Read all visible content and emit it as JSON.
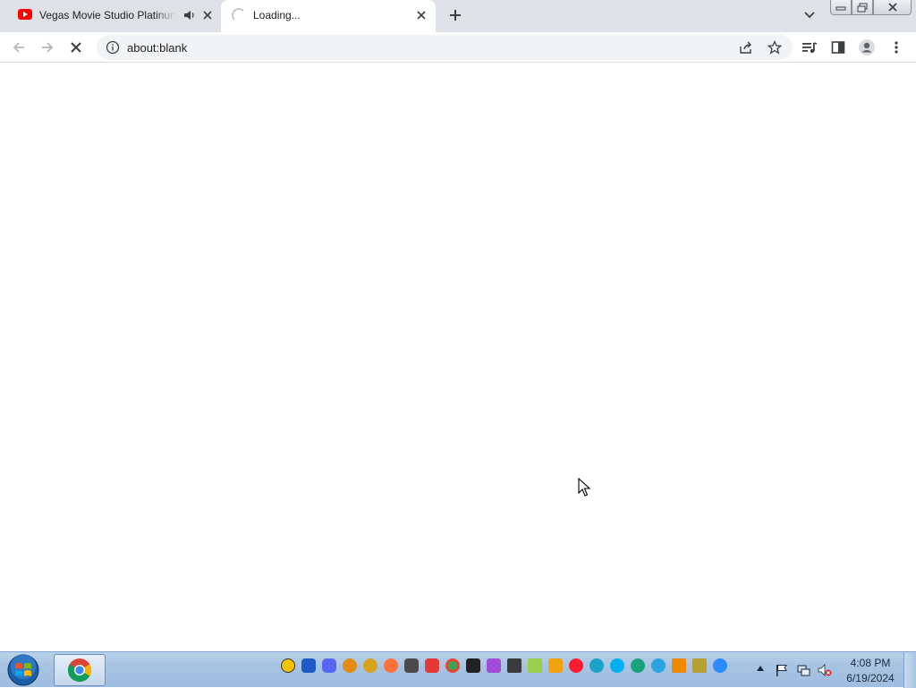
{
  "browser": {
    "tabs": [
      {
        "title": "Vegas Movie Studio Platinum",
        "favicon": "youtube-icon",
        "audio": true,
        "active": false
      },
      {
        "title": "Loading...",
        "favicon": "loading-spinner-icon",
        "audio": false,
        "active": true
      }
    ],
    "new_tab_icon": "plus-icon",
    "tab_search_icon": "chevron-down-icon",
    "window_controls": [
      "minimize-icon",
      "maximize-icon",
      "close-icon"
    ]
  },
  "toolbar": {
    "back_icon": "back-arrow-icon",
    "forward_icon": "forward-arrow-icon",
    "stop_icon": "stop-icon",
    "site_info_icon": "info-icon",
    "url": "about:blank",
    "share_icon": "share-icon",
    "bookmark_icon": "star-icon",
    "media_icon": "media-control-icon",
    "side_panel_icon": "side-panel-icon",
    "profile_icon": "profile-icon",
    "menu_icon": "more-vert-icon"
  },
  "taskbar": {
    "start_icon": "windows-start-icon",
    "pinned": [
      "chrome-icon"
    ],
    "tray_apps": [
      "triangle-app-icon",
      "headphones-app-icon",
      "discord-icon",
      "search-app-icon",
      "flower-app-icon",
      "firefox-icon",
      "gamepad-app-icon",
      "red-app-icon",
      "chrome-icon",
      "inkscape-icon",
      "colorful-app-icon",
      "film-app-icon",
      "notes-app-icon",
      "zap-app-icon",
      "opera-icon",
      "edge-icon",
      "skype-icon",
      "chat-app-icon",
      "telegram-icon",
      "vlc-icon",
      "pencil-app-icon",
      "zoom-icon"
    ],
    "tray_icons": [
      "flag-icon",
      "network-icon",
      "volume-muted-icon"
    ],
    "time": "4:08 PM",
    "date": "6/19/2024"
  },
  "colors": {
    "tabstrip_bg": "#dee1e6",
    "omnibox_bg": "#f1f3f4",
    "taskbar_bg": "#a7c3e2",
    "youtube_red": "#ff0000"
  }
}
